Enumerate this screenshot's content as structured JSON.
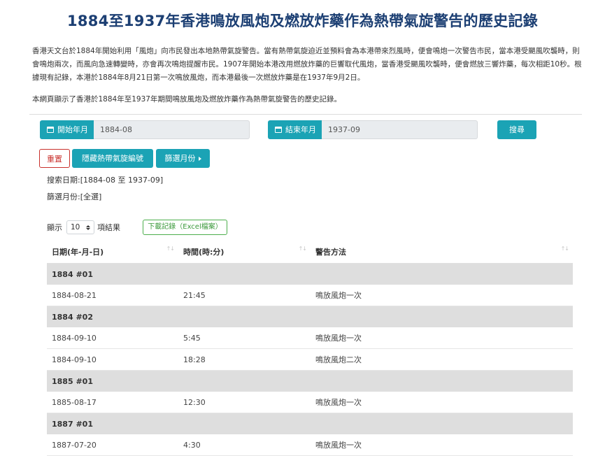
{
  "page": {
    "title": "1884至1937年香港鳴放風炮及燃放炸藥作為熱帶氣旋警告的歷史記錄",
    "intro_paragraph_1": "香港天文台於1884年開始利用「風炮」向市民發出本地熱帶氣旋警告。當有熱帶氣旋迫近並預料會為本港帶來烈風時，便會鳴炮一次警告市民，當本港受颶風吹襲時，則會鳴炮兩次，而風向急速轉變時，亦會再次鳴炮提醒市民。1907年開始本港改用燃放炸藥的巨響取代風炮，當香港受颶風吹襲時，便會燃放三響炸藥，每次相距10秒。根據現有記錄，本港於1884年8月21日第一次鳴放風炮，而本港最後一次燃放炸藥是在1937年9月2日。",
    "intro_paragraph_2": "本網頁顯示了香港於1884年至1937年期間鳴放風炮及燃放炸藥作為熱帶氣旋警告的歷史記錄。"
  },
  "search": {
    "start_label": "開始年月",
    "start_value": "1884-08",
    "end_label": "結束年月",
    "end_value": "1937-09",
    "search_button": "搜尋",
    "reset_button": "重置",
    "hide_button": "隱藏熱帶氣旋編號",
    "filter_button": "篩選月份",
    "search_date_text": "搜索日期:[1884-08 至 1937-09]",
    "filter_month_text": "篩選月份:[全選]"
  },
  "table_controls": {
    "show_prefix": "顯示",
    "page_size": "10",
    "show_suffix": "項結果",
    "download_button": "下載記錄（Excel檔案）"
  },
  "table": {
    "headers": [
      "日期(年-月-日)",
      "時間(時:分)",
      "警告方法"
    ],
    "sort_glyph": "↑↓",
    "rows": [
      {
        "type": "group",
        "label": "1884 #01"
      },
      {
        "type": "data",
        "date": "1884-08-21",
        "time": "21:45",
        "method": "鳴放風炮一次"
      },
      {
        "type": "group",
        "label": "1884 #02"
      },
      {
        "type": "data",
        "date": "1884-09-10",
        "time": "5:45",
        "method": "鳴放風炮一次"
      },
      {
        "type": "data",
        "date": "1884-09-10",
        "time": "18:28",
        "method": "鳴放風炮二次"
      },
      {
        "type": "group",
        "label": "1885 #01"
      },
      {
        "type": "data",
        "date": "1885-08-17",
        "time": "12:30",
        "method": "鳴放風炮一次"
      },
      {
        "type": "group",
        "label": "1887 #01"
      },
      {
        "type": "data",
        "date": "1887-07-20",
        "time": "4:30",
        "method": "鳴放風炮一次"
      }
    ]
  },
  "colors": {
    "title": "#1c3f73",
    "accent": "#1ba3b5",
    "reset": "#c9302c",
    "download": "#4cae4c",
    "group_row": "#dedede"
  },
  "icons": {
    "date_label_icon": "calendar-icon",
    "page_size_icon": "up-down-icon",
    "filter_icon": "caret-right-icon"
  }
}
